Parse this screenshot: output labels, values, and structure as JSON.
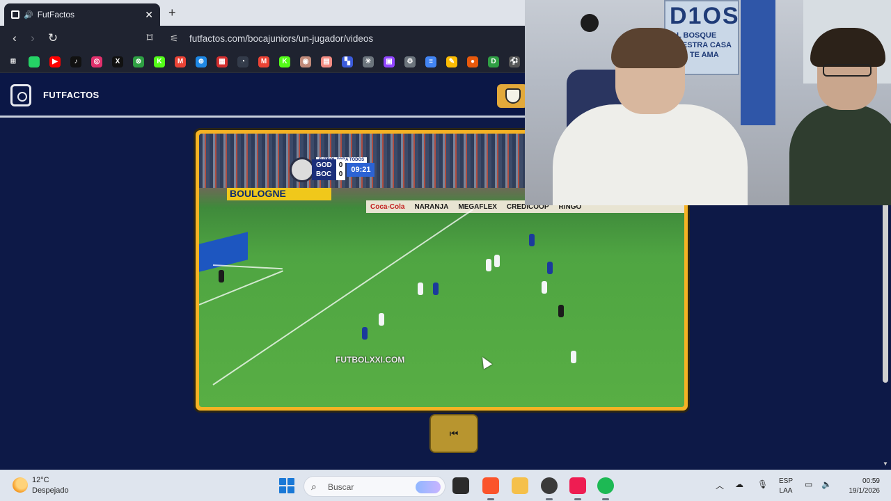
{
  "browser": {
    "tab_title": "FutFactos",
    "close_symbol": "✕",
    "new_tab_symbol": "+",
    "url": "futfactos.com/bocajuniors/un-jugador/videos"
  },
  "bookmarks": [
    {
      "name": "apps-grid-icon",
      "color": "#1f2330",
      "glyph": "⊞"
    },
    {
      "name": "whatsapp-icon",
      "color": "#25d366",
      "glyph": ""
    },
    {
      "name": "youtube-icon",
      "color": "#ff0000",
      "glyph": "▶"
    },
    {
      "name": "tiktok-icon",
      "color": "#111111",
      "glyph": "♪"
    },
    {
      "name": "instagram-icon",
      "color": "#e1306c",
      "glyph": "◎"
    },
    {
      "name": "x-icon",
      "color": "#111111",
      "glyph": "X"
    },
    {
      "name": "xbox-icon",
      "color": "#2ea043",
      "glyph": "⊗"
    },
    {
      "name": "kick-icon",
      "color": "#53fc18",
      "glyph": "K"
    },
    {
      "name": "gmail-icon",
      "color": "#ea4335",
      "glyph": "M"
    },
    {
      "name": "compass-icon",
      "color": "#1e88e5",
      "glyph": "⊕"
    },
    {
      "name": "chart-icon",
      "color": "#d32f2f",
      "glyph": "▦"
    },
    {
      "name": "speed-icon",
      "color": "#333b4a",
      "glyph": "◔"
    },
    {
      "name": "gmail-icon-2",
      "color": "#ea4335",
      "glyph": "M"
    },
    {
      "name": "kick-icon-2",
      "color": "#53fc18",
      "glyph": "K"
    },
    {
      "name": "map-icon",
      "color": "#c08a7a",
      "glyph": "◉"
    },
    {
      "name": "calendar-icon",
      "color": "#f28b82",
      "glyph": "▤"
    },
    {
      "name": "puzzle-icon",
      "color": "#3b5bdb",
      "glyph": "▚"
    },
    {
      "name": "network-icon",
      "color": "#6c757d",
      "glyph": "✳"
    },
    {
      "name": "twitch-icon",
      "color": "#9146ff",
      "glyph": "▣"
    },
    {
      "name": "settings-icon",
      "color": "#6c757d",
      "glyph": "⚙"
    },
    {
      "name": "docs-icon",
      "color": "#4285f4",
      "glyph": "≡"
    },
    {
      "name": "pen-icon",
      "color": "#fbbc04",
      "glyph": "✎"
    },
    {
      "name": "record-icon",
      "color": "#e8590c",
      "glyph": "●"
    },
    {
      "name": "d-icon",
      "color": "#2f9e44",
      "glyph": "D"
    },
    {
      "name": "soccer-icon",
      "color": "#555555",
      "glyph": "⚽"
    }
  ],
  "site": {
    "brand": "FUTFACTOS"
  },
  "video": {
    "overlay_label": "FUTBOL PARA TODOS",
    "team_home": "GOD",
    "team_away": "BOC",
    "score_home": "0",
    "score_away": "0",
    "clock": "09:21",
    "watermark": "FUTBOLXXI.COM",
    "board_left": "BOULOGNE",
    "board_items": [
      "Coca-Cola",
      "NARANJA",
      "MEGAFLEX",
      "CREDICOOP",
      "RINGO"
    ],
    "prev_button_symbol": "⏮"
  },
  "webcam": {
    "poster_title": "D1OS",
    "poster_line1": "AL BOSQUE",
    "poster_line2": "NUESTRA CASA",
    "poster_line3": "ERO TE AMA"
  },
  "taskbar": {
    "temperature": "12°C",
    "weather": "Despejado",
    "search_placeholder": "Buscar",
    "lang_top": "ESP",
    "lang_bottom": "LAA",
    "time": "00:59",
    "date": "19/1/2026",
    "tray_chevron": "︿"
  }
}
